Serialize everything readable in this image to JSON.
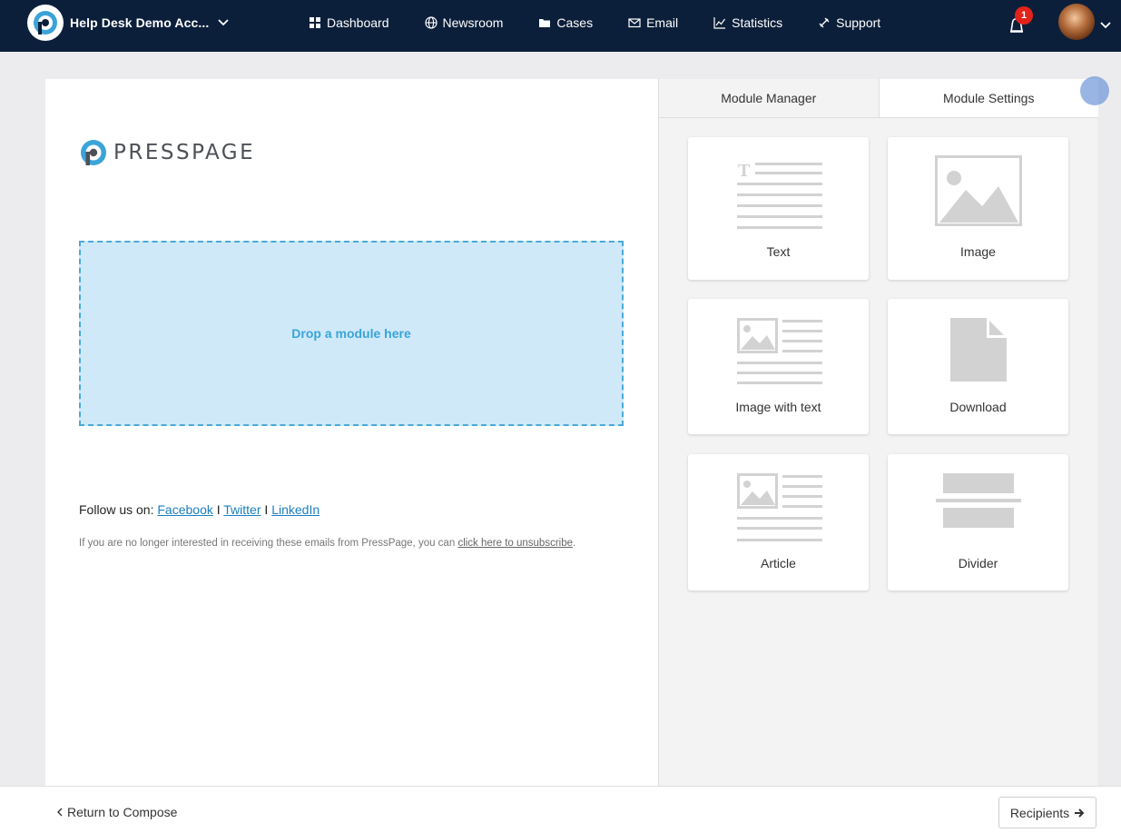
{
  "header": {
    "account_name": "Help Desk Demo Acc...",
    "nav": [
      {
        "label": "Dashboard",
        "icon": "grid-icon"
      },
      {
        "label": "Newsroom",
        "icon": "globe-icon"
      },
      {
        "label": "Cases",
        "icon": "folder-icon"
      },
      {
        "label": "Email",
        "icon": "envelope-icon"
      },
      {
        "label": "Statistics",
        "icon": "chart-icon"
      },
      {
        "label": "Support",
        "icon": "support-icon"
      }
    ],
    "notification_count": "1"
  },
  "editor": {
    "logo_text": "PRESSPAGE",
    "dropzone_text": "Drop a module here",
    "follow_prefix": "Follow us on:",
    "social_links": [
      "Facebook",
      "Twitter",
      "LinkedIn"
    ],
    "separator": "I",
    "unsubscribe_text": "If you are no longer interested in receiving these emails from PressPage, you can",
    "unsubscribe_link": "click here to unsubscribe",
    "unsubscribe_end": "."
  },
  "panel": {
    "tabs": [
      "Module Manager",
      "Module Settings"
    ],
    "modules": [
      "Text",
      "Image",
      "Image with text",
      "Download",
      "Article",
      "Divider"
    ]
  },
  "footer": {
    "back_label": "Return to Compose",
    "next_label": "Recipients"
  },
  "colors": {
    "nav_bg": "#0c1f3a",
    "dropzone_bg": "#cfe9f8",
    "dropzone_border": "#4aa9d8",
    "link": "#1a7fc0",
    "badge": "#e2231a"
  }
}
